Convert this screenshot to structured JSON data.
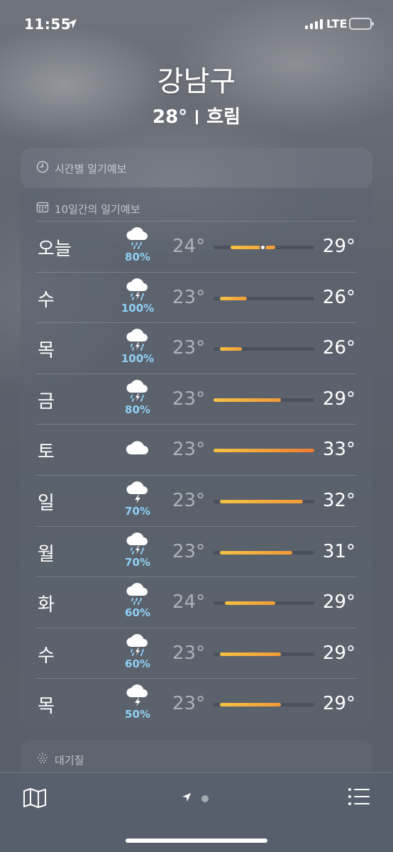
{
  "status_bar": {
    "time": "11:55",
    "network": "LTE"
  },
  "header": {
    "city": "강남구",
    "temperature": "28°",
    "condition": "흐림"
  },
  "hourly_card": {
    "title": "시간별 일기예보"
  },
  "tenday_card": {
    "title": "10일간의 일기예보",
    "days": [
      {
        "day": "오늘",
        "pop": "80%",
        "icon": "cloud-rain-icon",
        "low": "24°",
        "high": "29°",
        "bar_start": 0.17,
        "bar_end": 0.61,
        "now": 0.49
      },
      {
        "day": "수",
        "pop": "100%",
        "icon": "cloud-thunderstorm-rain-icon",
        "low": "23°",
        "high": "26°",
        "bar_start": 0.06,
        "bar_end": 0.33
      },
      {
        "day": "목",
        "pop": "100%",
        "icon": "cloud-thunderstorm-rain-icon",
        "low": "23°",
        "high": "26°",
        "bar_start": 0.06,
        "bar_end": 0.28
      },
      {
        "day": "금",
        "pop": "80%",
        "icon": "cloud-thunderstorm-rain-icon",
        "low": "23°",
        "high": "29°",
        "bar_start": 0.0,
        "bar_end": 0.67
      },
      {
        "day": "토",
        "pop": "",
        "icon": "cloud-icon",
        "low": "23°",
        "high": "33°",
        "bar_start": 0.0,
        "bar_end": 1.0
      },
      {
        "day": "일",
        "pop": "70%",
        "icon": "cloud-thunderstorm-icon",
        "low": "23°",
        "high": "32°",
        "bar_start": 0.06,
        "bar_end": 0.89
      },
      {
        "day": "월",
        "pop": "70%",
        "icon": "cloud-thunderstorm-rain-icon",
        "low": "23°",
        "high": "31°",
        "bar_start": 0.06,
        "bar_end": 0.78
      },
      {
        "day": "화",
        "pop": "60%",
        "icon": "cloud-rain-icon",
        "low": "24°",
        "high": "29°",
        "bar_start": 0.11,
        "bar_end": 0.61
      },
      {
        "day": "수",
        "pop": "60%",
        "icon": "cloud-thunderstorm-rain-icon",
        "low": "23°",
        "high": "29°",
        "bar_start": 0.06,
        "bar_end": 0.67
      },
      {
        "day": "목",
        "pop": "50%",
        "icon": "cloud-thunderstorm-icon",
        "low": "23°",
        "high": "29°",
        "bar_start": 0.06,
        "bar_end": 0.67
      }
    ]
  },
  "aqi_card": {
    "title": "대기질"
  },
  "colors": {
    "bar_yellow": "#f5c242",
    "bar_orange": "#f29a3a",
    "bar_deep": "#ee7a30",
    "precip": "#8fd0f7"
  }
}
